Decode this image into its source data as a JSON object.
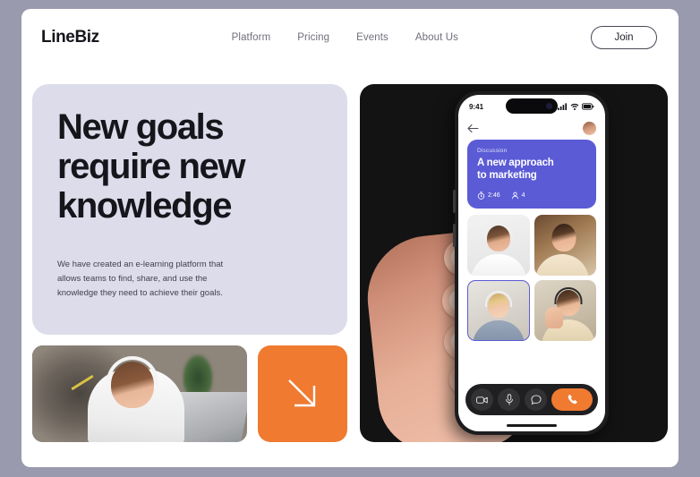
{
  "theme": {
    "page_bg": "#9a9aae",
    "card_bg": "#ffffff",
    "hero_bg": "#dcdcea",
    "accent_orange": "#ef7a30",
    "accent_purple": "#5b5bd6",
    "dark_panel": "#131313"
  },
  "header": {
    "logo": "LineBiz",
    "nav": [
      {
        "label": "Platform"
      },
      {
        "label": "Pricing"
      },
      {
        "label": "Events"
      },
      {
        "label": "About Us"
      }
    ],
    "join_label": "Join"
  },
  "hero": {
    "title_line1": "New goals",
    "title_line2": "require new",
    "title_line3": "knowledge",
    "paragraph": "We have created an e-learning platform that allows teams to find, share, and use the knowledge they need to achieve their goals."
  },
  "tiles": {
    "photo_alt": "woman-with-headphones-at-laptop",
    "arrow_icon": "arrow-down-right-icon"
  },
  "phone": {
    "status": {
      "time": "9:41",
      "signal_icon": "cellular-signal-icon",
      "wifi_icon": "wifi-icon",
      "battery_icon": "battery-icon"
    },
    "topbar": {
      "back_icon": "back-arrow-icon",
      "avatar": "user-avatar"
    },
    "discussion": {
      "label": "Discussion",
      "title_line1": "A new approach",
      "title_line2": "to marketing",
      "timer_icon": "stopwatch-icon",
      "timer_value": "2:46",
      "people_icon": "person-icon",
      "people_count": "4"
    },
    "participants": [
      {
        "name": "participant-1",
        "active": false
      },
      {
        "name": "participant-2",
        "active": false
      },
      {
        "name": "participant-3",
        "active": true
      },
      {
        "name": "participant-4",
        "active": false
      }
    ],
    "controls": [
      {
        "name": "video-camera-icon",
        "label": "video"
      },
      {
        "name": "microphone-icon",
        "label": "mic"
      },
      {
        "name": "chat-bubble-icon",
        "label": "chat"
      },
      {
        "name": "end-call-icon",
        "label": "end"
      }
    ]
  }
}
